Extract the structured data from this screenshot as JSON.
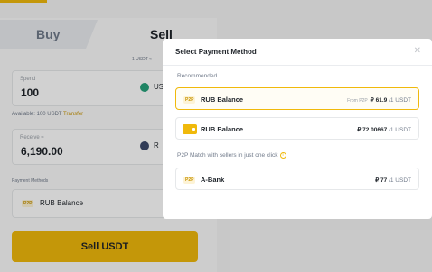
{
  "trade": {
    "tab_buy": "Buy",
    "tab_sell": "Sell",
    "rate_hint": "1 USDT ≈",
    "spend": {
      "label": "Spend",
      "value": "100",
      "currency": "US"
    },
    "available": {
      "text": "Available: 100 USDT",
      "link": "Transfer"
    },
    "receive": {
      "label": "Receive ≈",
      "value": "6,190.00",
      "currency": "R"
    },
    "payment_methods_label": "Payment Methods",
    "payment_method": {
      "tag": "P2P",
      "name": "RUB Balance"
    },
    "sell_button": "Sell USDT"
  },
  "modal": {
    "title": "Select Payment Method",
    "close_icon": "close-icon",
    "recommended_label": "Recommended",
    "options": [
      {
        "tag": "P2P",
        "name": "RUB Balance",
        "from_text": "From P2P",
        "price": "₽ 61.9",
        "unit": "/1 USDT",
        "selected": true
      },
      {
        "icon": "wallet-icon",
        "name": "RUB Balance",
        "price": "₽ 72.00667",
        "unit": "/1 USDT",
        "selected": false
      }
    ],
    "p2p_label": "P2P Match with sellers in just one click",
    "p2p_options": [
      {
        "tag": "P2P",
        "name": "A-Bank",
        "price": "₽ 77",
        "unit": "/1 USDT"
      }
    ]
  },
  "colors": {
    "accent": "#f0b90b",
    "text": "#1e2329",
    "muted": "#707a8a",
    "tether": "#26a17b",
    "ruble": "#3c4a6b"
  }
}
